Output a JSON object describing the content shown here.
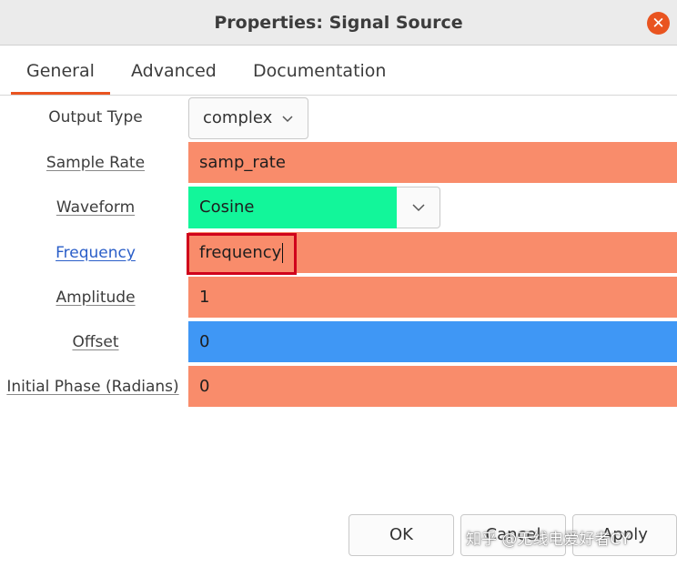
{
  "window": {
    "title": "Properties: Signal Source",
    "close_glyph": "✕"
  },
  "tabs": [
    {
      "label": "General",
      "active": true
    },
    {
      "label": "Advanced",
      "active": false
    },
    {
      "label": "Documentation",
      "active": false
    }
  ],
  "fields": {
    "output_type": {
      "label": "Output Type",
      "value": "complex"
    },
    "sample_rate": {
      "label": "Sample Rate",
      "value": "samp_rate"
    },
    "waveform": {
      "label": "Waveform",
      "value": "Cosine"
    },
    "frequency": {
      "label": "Frequency",
      "value": "frequency"
    },
    "amplitude": {
      "label": "Amplitude",
      "value": "1"
    },
    "offset": {
      "label": "Offset",
      "value": "0"
    },
    "initial_phase": {
      "label": "Initial Phase (Radians)",
      "value": "0"
    }
  },
  "buttons": {
    "ok": "OK",
    "cancel": "Cancel",
    "apply": "Apply"
  },
  "watermark": "知乎 @无线电爱好者CY",
  "colors": {
    "accent": "#e95420",
    "field_orange": "#f98c6b",
    "field_green": "#12f69a",
    "field_blue": "#3f97f5",
    "highlight_red": "#d0021b",
    "link_blue": "#2a5ec8"
  }
}
